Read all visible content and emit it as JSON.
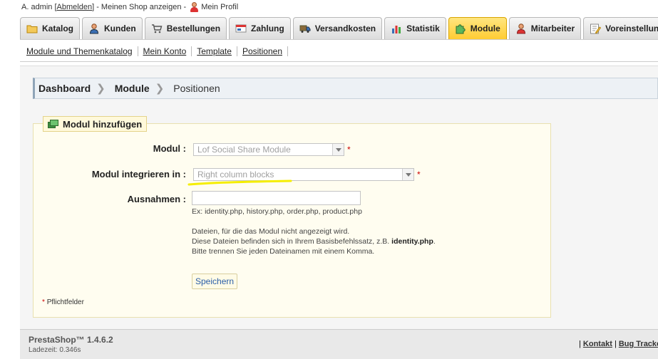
{
  "user_bar": {
    "name": "A. admin",
    "logout_prefix": "[",
    "logout_label": "Abmelden",
    "logout_suffix": "] - Meinen Shop anzeigen -",
    "profile_label": "Mein Profil"
  },
  "tabs": [
    {
      "label": "Katalog",
      "icon": "folder-icon"
    },
    {
      "label": "Kunden",
      "icon": "customers-icon"
    },
    {
      "label": "Bestellungen",
      "icon": "cart-icon"
    },
    {
      "label": "Zahlung",
      "icon": "payment-icon"
    },
    {
      "label": "Versandkosten",
      "icon": "truck-icon"
    },
    {
      "label": "Statistik",
      "icon": "chart-icon"
    },
    {
      "label": "Module",
      "icon": "puzzle-icon",
      "active": true
    },
    {
      "label": "Mitarbeiter",
      "icon": "employee-icon"
    },
    {
      "label": "Voreinstellungen",
      "icon": "preferences-icon"
    }
  ],
  "submenu": [
    "Module und Themenkatalog",
    "Mein Konto",
    "Template",
    "Positionen"
  ],
  "breadcrumb": [
    "Dashboard",
    "Module",
    "Positionen"
  ],
  "form": {
    "legend": "Modul hinzufügen",
    "module_label": "Modul :",
    "module_value": "Lof Social Share Module",
    "hook_label": "Modul integrieren in :",
    "hook_value": "Right column blocks",
    "exceptions_label": "Ausnahmen :",
    "exceptions_value": "",
    "example": "Ex: identity.php, history.php, order.php, product.php",
    "help_line1": "Dateien, für die das Modul nicht angezeigt wird.",
    "help_line2_prefix": "Diese Dateien befinden sich in Ihrem Basisbefehlssatz, z.B. ",
    "help_line2_bold": "identity.php",
    "help_line2_suffix": ".",
    "help_line3": "Bitte trennen Sie jeden Dateinamen mit einem Komma.",
    "save_label": "Speichern",
    "required_star": "*",
    "required_note": "Pflichtfelder"
  },
  "footer": {
    "brand": "PrestaShop™ 1.4.6.2",
    "load_time": "Ladezeit: 0.346s",
    "link_sep": "|",
    "contact": "Kontakt",
    "bugtracker": "Bug Tracker"
  },
  "colors": {
    "active_tab": "#ffcc33",
    "highlight_marker": "#f5ee00",
    "required": "#cc0000"
  }
}
